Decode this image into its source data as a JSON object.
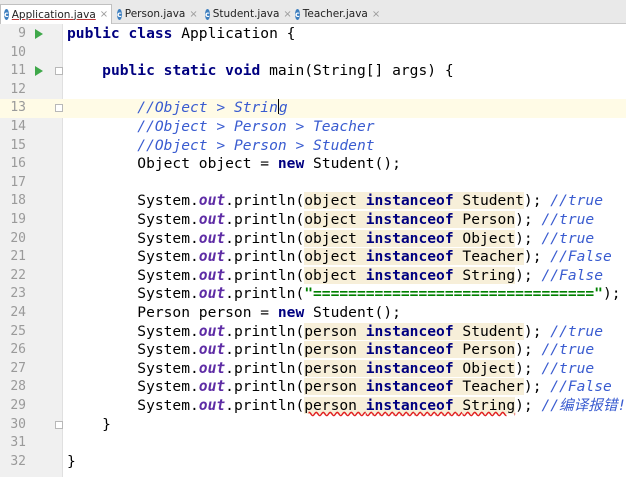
{
  "tabs": [
    {
      "label": "Application.java",
      "icon": "class-icon",
      "active": true
    },
    {
      "label": "Person.java",
      "icon": "class-icon",
      "active": false
    },
    {
      "label": "Student.java",
      "icon": "class-icon",
      "active": false
    },
    {
      "label": "Teacher.java",
      "icon": "class-icon",
      "active": false
    }
  ],
  "tab_icon_glyph": "c",
  "close_glyph": "×",
  "lines": [
    {
      "n": "9",
      "tokens": [
        [
          "kw",
          "public class "
        ],
        [
          "",
          "Application {"
        ]
      ]
    },
    {
      "n": "10",
      "tokens": []
    },
    {
      "n": "11",
      "tokens": [
        [
          "",
          "    "
        ],
        [
          "kw",
          "public static void "
        ],
        [
          "",
          "main(String[] args) {"
        ]
      ]
    },
    {
      "n": "12",
      "tokens": []
    },
    {
      "n": "13",
      "tokens": [
        [
          "",
          "        "
        ],
        [
          "cm",
          "//Object > Strin"
        ],
        [
          "caret",
          ""
        ],
        [
          "cm",
          "g"
        ]
      ]
    },
    {
      "n": "14",
      "tokens": [
        [
          "",
          "        "
        ],
        [
          "cm",
          "//Object > Person > Teacher"
        ]
      ]
    },
    {
      "n": "15",
      "tokens": [
        [
          "",
          "        "
        ],
        [
          "cm",
          "//Object > Person > Student"
        ]
      ]
    },
    {
      "n": "16",
      "tokens": [
        [
          "",
          "        Object object = "
        ],
        [
          "kw",
          "new "
        ],
        [
          "",
          "Student();"
        ]
      ]
    },
    {
      "n": "17",
      "tokens": []
    },
    {
      "n": "18",
      "tokens": [
        [
          "",
          "        System."
        ],
        [
          "fld",
          "out"
        ],
        [
          "",
          ".println("
        ],
        [
          "hl",
          "object "
        ],
        [
          "hl kw",
          "instanceof "
        ],
        [
          "hl",
          "Student"
        ],
        [
          "",
          "); "
        ],
        [
          "cm",
          "//true"
        ]
      ]
    },
    {
      "n": "19",
      "tokens": [
        [
          "",
          "        System."
        ],
        [
          "fld",
          "out"
        ],
        [
          "",
          ".println("
        ],
        [
          "hl",
          "object "
        ],
        [
          "hl kw",
          "instanceof "
        ],
        [
          "hl",
          "Person"
        ],
        [
          "",
          "); "
        ],
        [
          "cm",
          "//true"
        ]
      ]
    },
    {
      "n": "20",
      "tokens": [
        [
          "",
          "        System."
        ],
        [
          "fld",
          "out"
        ],
        [
          "",
          ".println("
        ],
        [
          "hl",
          "object "
        ],
        [
          "hl kw",
          "instanceof "
        ],
        [
          "hl",
          "Object"
        ],
        [
          "",
          "); "
        ],
        [
          "cm",
          "//true"
        ]
      ]
    },
    {
      "n": "21",
      "tokens": [
        [
          "",
          "        System."
        ],
        [
          "fld",
          "out"
        ],
        [
          "",
          ".println("
        ],
        [
          "hl",
          "object "
        ],
        [
          "hl kw",
          "instanceof "
        ],
        [
          "hl",
          "Teacher"
        ],
        [
          "",
          "); "
        ],
        [
          "cm",
          "//False"
        ]
      ]
    },
    {
      "n": "22",
      "tokens": [
        [
          "",
          "        System."
        ],
        [
          "fld",
          "out"
        ],
        [
          "",
          ".println("
        ],
        [
          "hl",
          "object "
        ],
        [
          "hl kw",
          "instanceof "
        ],
        [
          "hl",
          "String"
        ],
        [
          "",
          "); "
        ],
        [
          "cm",
          "//False"
        ]
      ]
    },
    {
      "n": "23",
      "tokens": [
        [
          "",
          "        System."
        ],
        [
          "fld",
          "out"
        ],
        [
          "",
          ".println("
        ],
        [
          "str",
          "\"================================\""
        ],
        [
          "",
          ");"
        ]
      ]
    },
    {
      "n": "24",
      "tokens": [
        [
          "",
          "        Person person = "
        ],
        [
          "kw",
          "new "
        ],
        [
          "",
          "Student();"
        ]
      ]
    },
    {
      "n": "25",
      "tokens": [
        [
          "",
          "        System."
        ],
        [
          "fld",
          "out"
        ],
        [
          "",
          ".println("
        ],
        [
          "hl",
          "person "
        ],
        [
          "hl kw",
          "instanceof "
        ],
        [
          "hl",
          "Student"
        ],
        [
          "",
          "); "
        ],
        [
          "cm",
          "//true"
        ]
      ]
    },
    {
      "n": "26",
      "tokens": [
        [
          "",
          "        System."
        ],
        [
          "fld",
          "out"
        ],
        [
          "",
          ".println("
        ],
        [
          "hl",
          "person "
        ],
        [
          "hl kw",
          "instanceof "
        ],
        [
          "hl",
          "Person"
        ],
        [
          "",
          "); "
        ],
        [
          "cm",
          "//true"
        ]
      ]
    },
    {
      "n": "27",
      "tokens": [
        [
          "",
          "        System."
        ],
        [
          "fld",
          "out"
        ],
        [
          "",
          ".println("
        ],
        [
          "hl",
          "person "
        ],
        [
          "hl kw",
          "instanceof "
        ],
        [
          "hl",
          "Object"
        ],
        [
          "",
          "); "
        ],
        [
          "cm",
          "//true"
        ]
      ]
    },
    {
      "n": "28",
      "tokens": [
        [
          "",
          "        System."
        ],
        [
          "fld",
          "out"
        ],
        [
          "",
          ".println("
        ],
        [
          "hl",
          "person "
        ],
        [
          "hl kw",
          "instanceof "
        ],
        [
          "hl",
          "Teacher"
        ],
        [
          "",
          "); "
        ],
        [
          "cm",
          "//False"
        ]
      ]
    },
    {
      "n": "29",
      "tokens": [
        [
          "",
          "        System."
        ],
        [
          "fld",
          "out"
        ],
        [
          "",
          ".println("
        ],
        [
          "hl err",
          "person "
        ],
        [
          "hl kw err",
          "instanceof "
        ],
        [
          "hl err",
          "String"
        ],
        [
          "",
          "); "
        ],
        [
          "cm",
          "//编译报错!"
        ]
      ]
    },
    {
      "n": "30",
      "tokens": [
        [
          "",
          "    }"
        ]
      ]
    },
    {
      "n": "31",
      "tokens": []
    },
    {
      "n": "32",
      "tokens": [
        [
          "",
          "}"
        ]
      ]
    }
  ],
  "gutter_markers": {
    "run": [
      "9",
      "11"
    ],
    "fold": [
      "11",
      "13",
      "30"
    ]
  },
  "current_line": "13"
}
